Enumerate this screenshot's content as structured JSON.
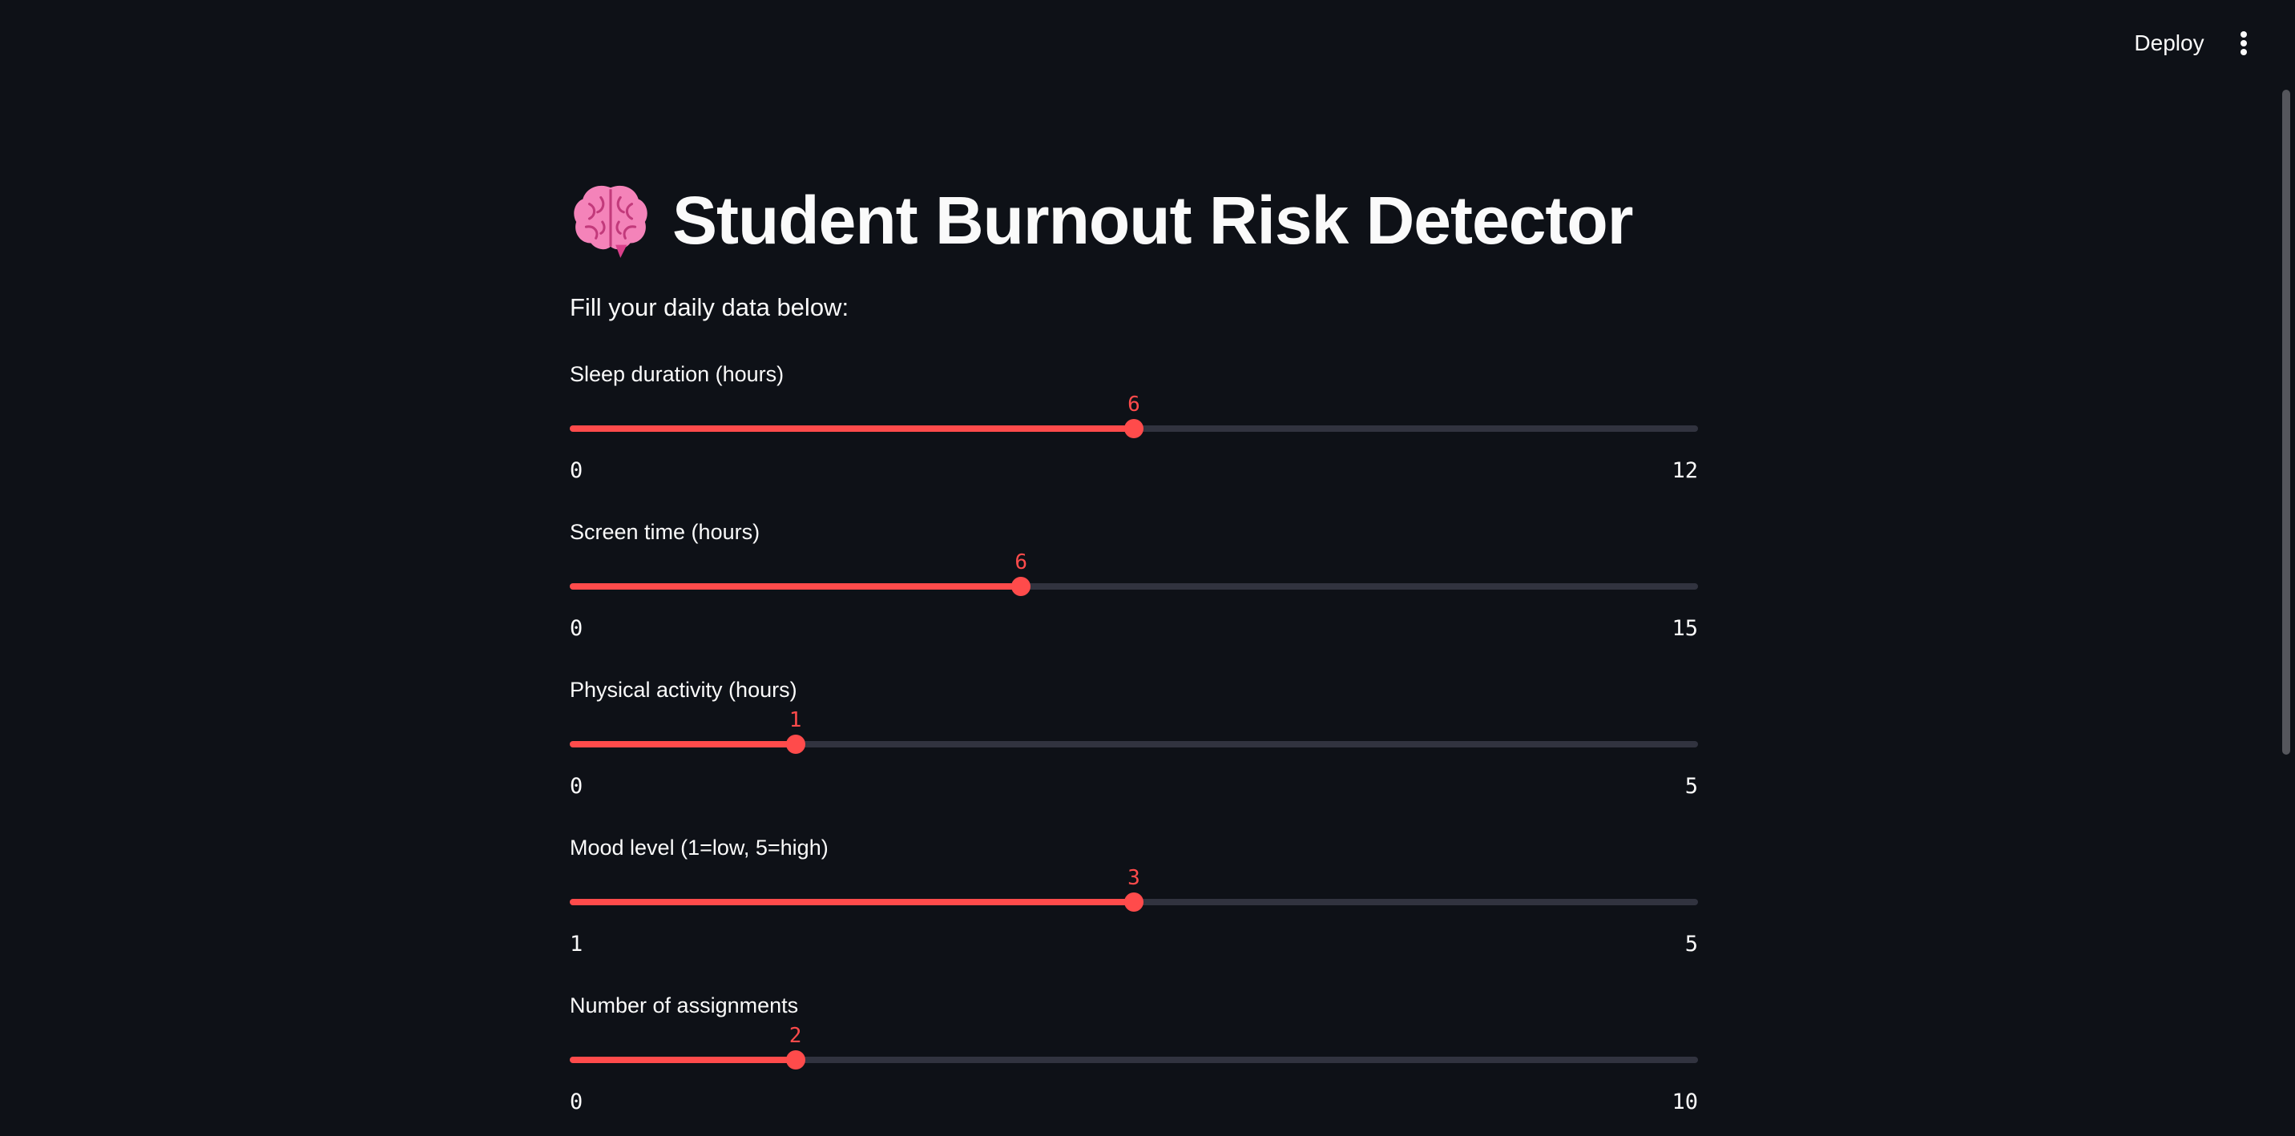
{
  "header": {
    "deploy_label": "Deploy",
    "menu_icon": "vertical-ellipsis-icon"
  },
  "main": {
    "title": "Student Burnout Risk Detector",
    "title_icon": "brain-icon",
    "subtitle": "Fill your daily data below:"
  },
  "colors": {
    "background": "#0e1117",
    "accent": "#ff4b4b",
    "track": "#31333f",
    "text": "#fafafa"
  },
  "sliders": [
    {
      "label": "Sleep duration (hours)",
      "value": 6,
      "min": 0,
      "max": 12
    },
    {
      "label": "Screen time (hours)",
      "value": 6,
      "min": 0,
      "max": 15
    },
    {
      "label": "Physical activity (hours)",
      "value": 1,
      "min": 0,
      "max": 5
    },
    {
      "label": "Mood level (1=low, 5=high)",
      "value": 3,
      "min": 1,
      "max": 5
    },
    {
      "label": "Number of assignments",
      "value": 2,
      "min": 0,
      "max": 10
    }
  ]
}
